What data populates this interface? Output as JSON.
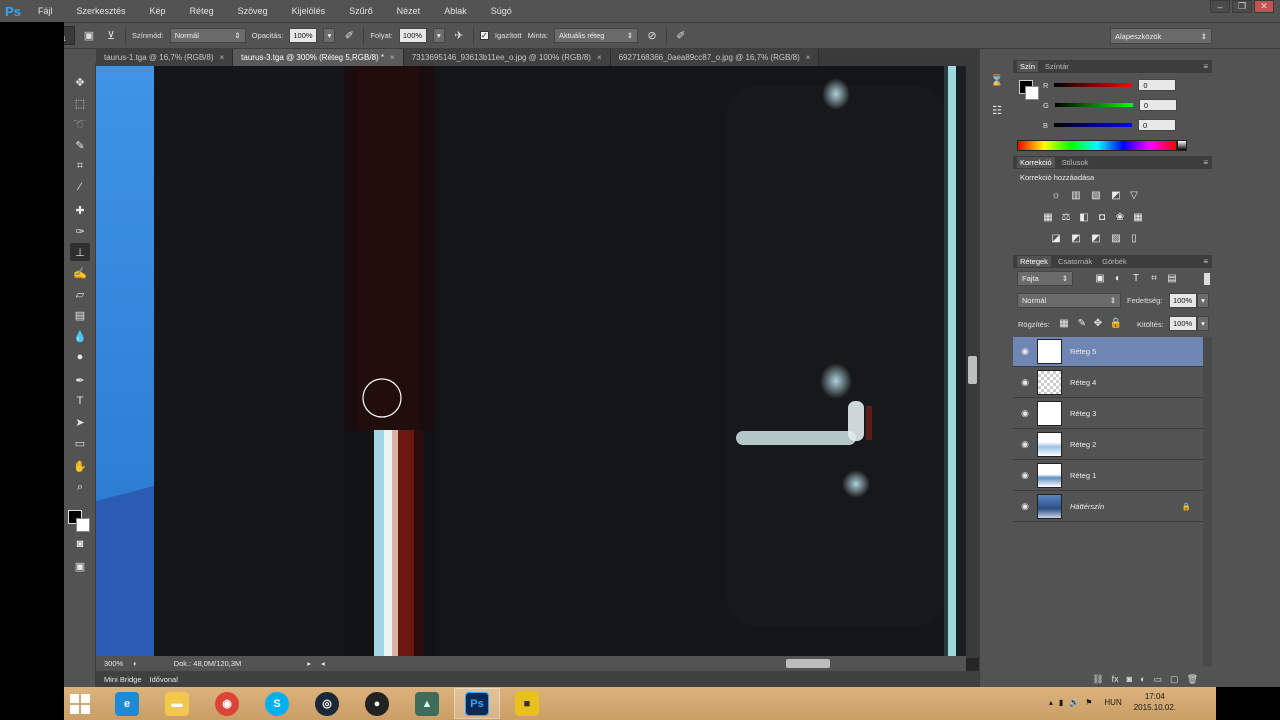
{
  "app": {
    "logo": "Ps"
  },
  "menu": [
    "Fájl",
    "Szerkesztés",
    "Kép",
    "Réteg",
    "Szöveg",
    "Kijelölés",
    "Szűrő",
    "Nézet",
    "Ablak",
    "Súgó"
  ],
  "window_controls": {
    "minimize": "–",
    "restore": "❐",
    "close": "✕"
  },
  "options": {
    "brush_size": "21",
    "mode_label": "Színmód:",
    "mode_value": "Normál",
    "opacity_label": "Opacitás:",
    "opacity_value": "100%",
    "flow_label": "Folyat:",
    "flow_value": "100%",
    "aligned_label": "Igazított",
    "sample_label": "Minta:",
    "sample_value": "Aktuális réteg",
    "workspace": "Alapeszközök"
  },
  "tabs": [
    {
      "label": "taurus-1.tga @ 16,7% (RGB/8)",
      "active": false
    },
    {
      "label": "taurus-3.tga @ 300% (Réteg 5,RGB/8) *",
      "active": true
    },
    {
      "label": "7313695146_93613b11ee_o.jpg @ 100% (RGB/8)",
      "active": false
    },
    {
      "label": "6927168366_0aea89cc87_o.jpg @ 16,7% (RGB/8)",
      "active": false
    }
  ],
  "tab_close": "×",
  "status": {
    "zoom": "300%",
    "doc": "Dok.: 48,0M/120,3M"
  },
  "bottom_tabs": [
    "Mini Bridge",
    "Idővonal"
  ],
  "color_panel": {
    "tabs": [
      "Szín",
      "Színtár"
    ],
    "channels": [
      {
        "name": "R",
        "value": "0",
        "color": "#ff0000"
      },
      {
        "name": "G",
        "value": "0",
        "color": "#00ff00"
      },
      {
        "name": "B",
        "value": "0",
        "color": "#0000ff"
      }
    ]
  },
  "adjust_panel": {
    "tabs": [
      "Korrekció",
      "Stílusok"
    ],
    "title": "Korrekció hozzáadása"
  },
  "layers_panel": {
    "tabs": [
      "Rétegek",
      "Csatornák",
      "Görbék"
    ],
    "filter": "Fajta",
    "blend": "Normál",
    "opacity_label": "Fedettség:",
    "opacity_value": "100%",
    "lock_label": "Rögzítés:",
    "fill_label": "Kitöltés:",
    "fill_value": "100%",
    "layers": [
      {
        "name": "Réteg 5",
        "selected": true,
        "thumb": "checker"
      },
      {
        "name": "Réteg 4",
        "selected": false,
        "thumb": "checker"
      },
      {
        "name": "Réteg 3",
        "selected": false,
        "thumb": "white"
      },
      {
        "name": "Réteg 2",
        "selected": false,
        "thumb": "sky"
      },
      {
        "name": "Réteg 1",
        "selected": false,
        "thumb": "sky"
      },
      {
        "name": "Háttérszín",
        "selected": false,
        "thumb": "photo"
      }
    ],
    "footer_icons": [
      "link-icon",
      "fx-icon",
      "mask-icon",
      "adjustment-icon",
      "group-icon",
      "new-layer-icon",
      "trash-icon"
    ]
  },
  "taskbar": {
    "apps": [
      {
        "name": "internet-explorer",
        "glyph": "e",
        "bg": "#1e8ad6",
        "running": false
      },
      {
        "name": "file-explorer",
        "glyph": "▬",
        "bg": "#f1c84b",
        "running": false
      },
      {
        "name": "chrome",
        "glyph": "◉",
        "bg": "#db4437",
        "running": false
      },
      {
        "name": "skype",
        "glyph": "S",
        "bg": "#00aff0",
        "running": false
      },
      {
        "name": "steam",
        "glyph": "◎",
        "bg": "#1b2838",
        "running": false
      },
      {
        "name": "obs",
        "glyph": "●",
        "bg": "#222222",
        "running": false
      },
      {
        "name": "game",
        "glyph": "▲",
        "bg": "#3f6b5a",
        "running": false
      },
      {
        "name": "photoshop",
        "glyph": "Ps",
        "bg": "#0a2a55",
        "running": true
      },
      {
        "name": "bus-app",
        "glyph": "■",
        "bg": "#e8c11c",
        "running": false
      }
    ],
    "lang": "HUN",
    "time": "17:04",
    "date": "2015.10.02."
  }
}
